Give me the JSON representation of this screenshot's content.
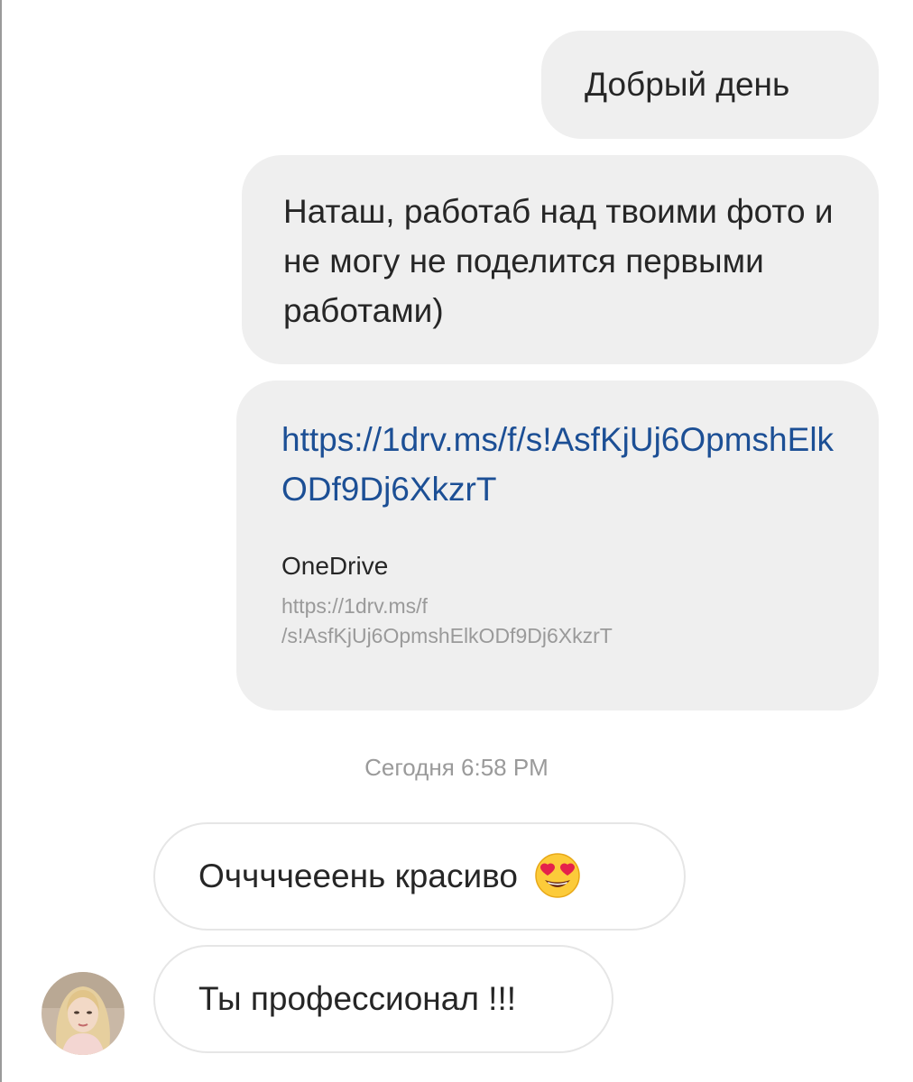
{
  "messages": {
    "greeting": "Добрый день",
    "long_text": "Наташ, работаб над твоими фото и не могу не поделится первыми работами)",
    "link_text": "https://1drv.ms/f/s!AsfKjUj6OpmshElkODf9Dj6XkzrT",
    "preview_title": "OneDrive",
    "preview_url": "https://1drv.ms/f\n/s!AsfKjUj6OpmshElkODf9Dj6XkzrT"
  },
  "timestamp": "Сегодня 6:58 PM",
  "replies": {
    "reply1": "Оччччееень красиво",
    "reply1_emoji": "heart-eyes-emoji-icon",
    "reply2": "Ты профессионал !!!"
  },
  "avatar": {
    "icon": "avatar-icon"
  },
  "colors": {
    "outgoing_bubble": "#efefef",
    "incoming_border": "#e6e6e6",
    "link": "#1c4f95",
    "muted_text": "#9a9a9a",
    "text": "#262626"
  }
}
